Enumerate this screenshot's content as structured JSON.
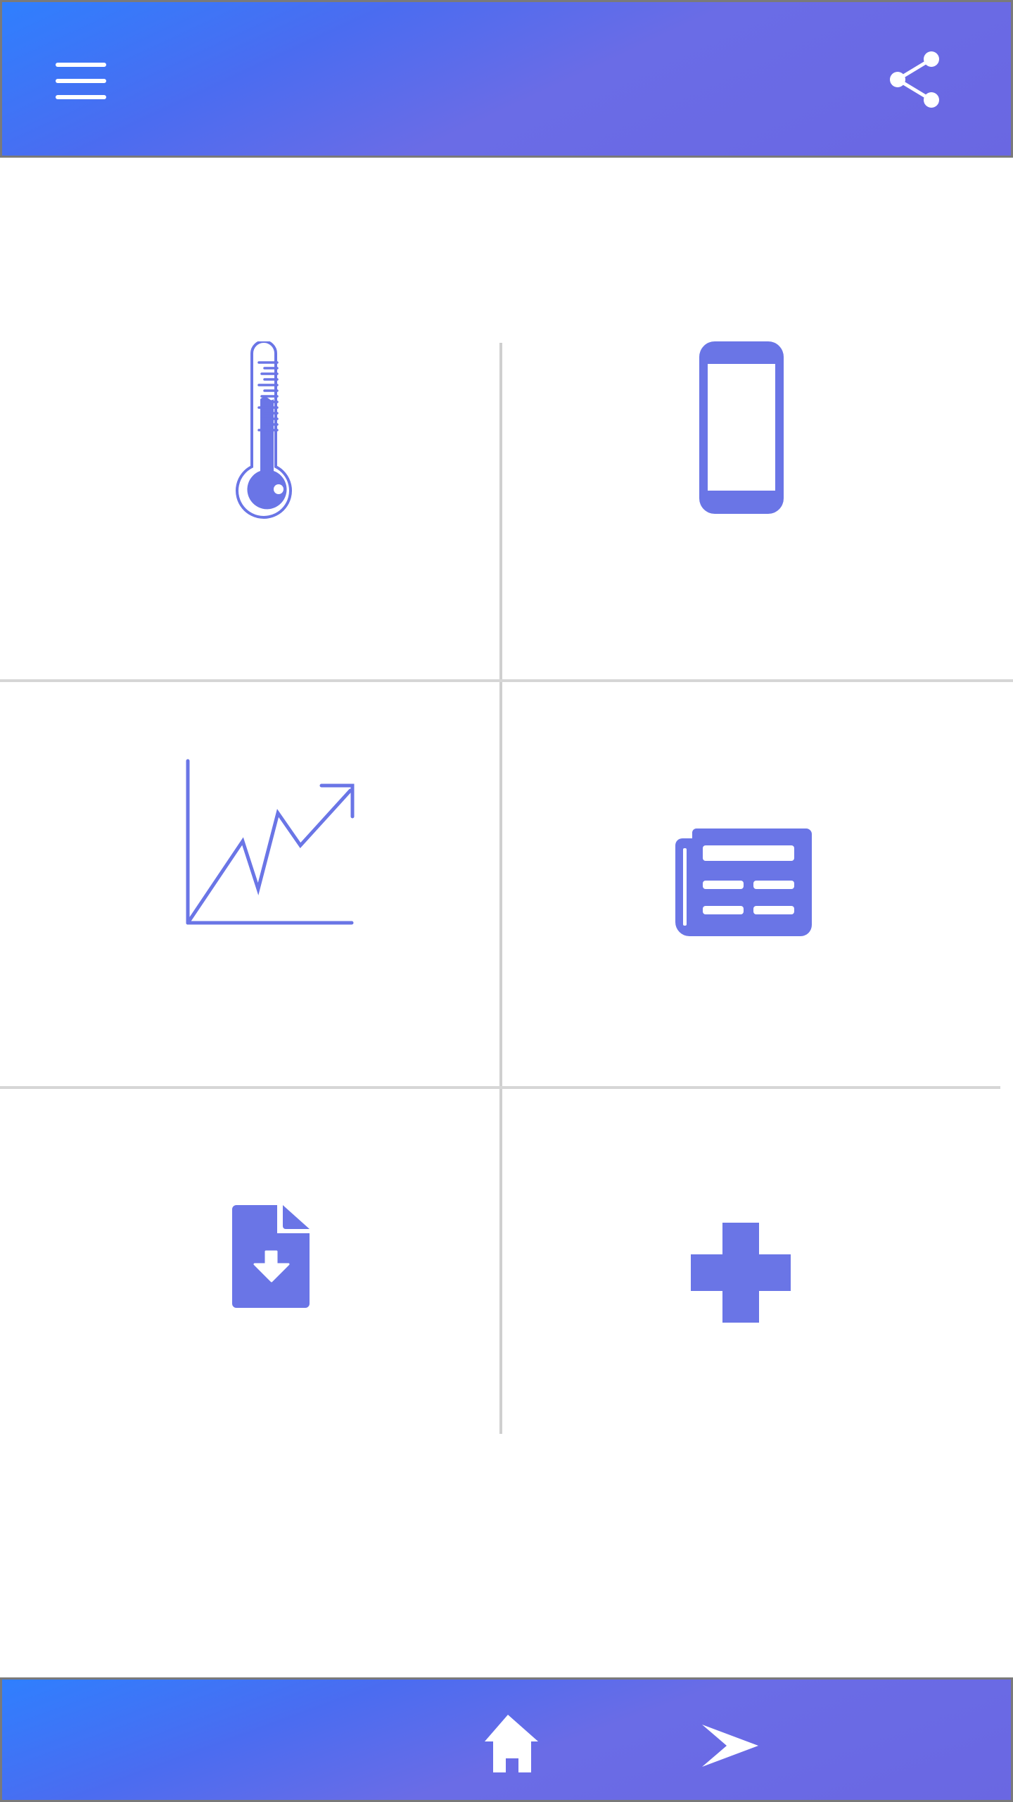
{
  "theme": {
    "accent": "#6a75e6",
    "bar_gradient_start": "#2f7ffe",
    "bar_gradient_end": "#6a67e2",
    "divider": "#d6d6d6"
  },
  "header": {
    "menu_icon": "hamburger-menu-icon",
    "share_icon": "share-icon"
  },
  "grid": {
    "tiles": [
      {
        "icon": "thermometer-icon"
      },
      {
        "icon": "smartphone-icon"
      },
      {
        "icon": "trending-chart-icon"
      },
      {
        "icon": "newspaper-icon"
      },
      {
        "icon": "file-download-icon"
      },
      {
        "icon": "medical-cross-icon"
      }
    ]
  },
  "bottom_nav": {
    "items": [
      {
        "icon": "home-icon"
      },
      {
        "icon": "send-icon"
      }
    ]
  }
}
